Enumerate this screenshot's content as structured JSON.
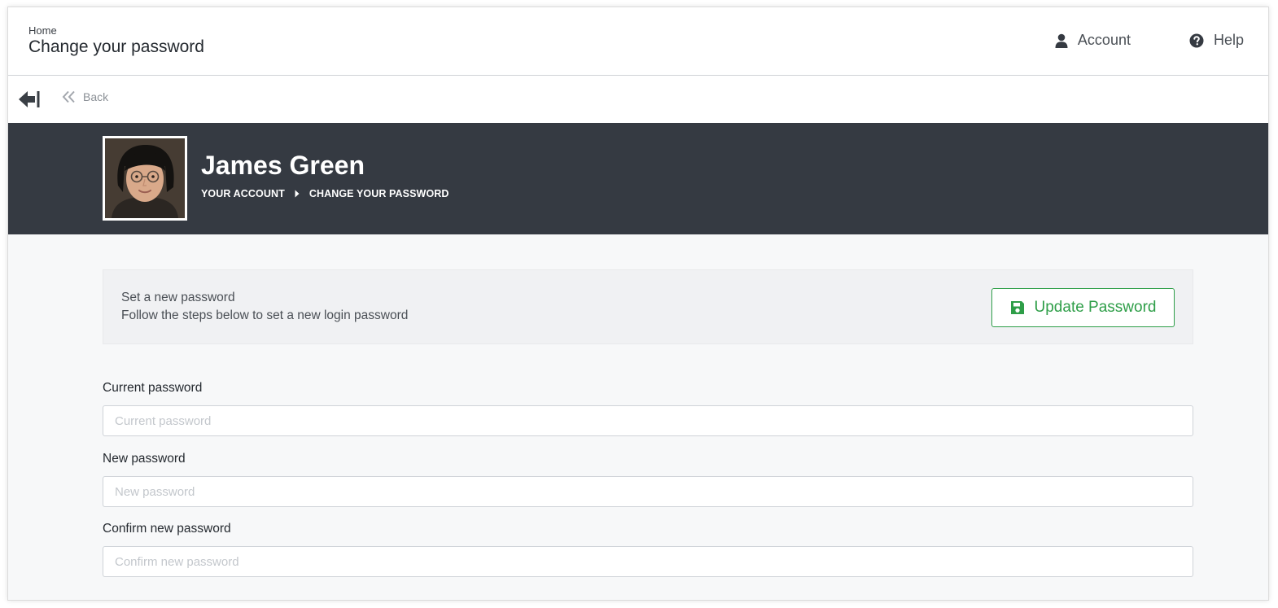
{
  "header": {
    "breadcrumb_home": "Home",
    "title": "Change your password",
    "account_label": "Account",
    "help_label": "Help"
  },
  "toolbar": {
    "back_label": "Back"
  },
  "profile": {
    "name": "James Green",
    "crumbs": [
      "YOUR ACCOUNT",
      "CHANGE YOUR PASSWORD"
    ]
  },
  "info": {
    "title": "Set a new password",
    "subtitle": "Follow the steps below to set a new login password",
    "update_button": "Update Password"
  },
  "form": {
    "current": {
      "label": "Current password",
      "value": "",
      "placeholder": "Current password"
    },
    "new": {
      "label": "New password",
      "value": "",
      "placeholder": "New password"
    },
    "confirm": {
      "label": "Confirm new password",
      "value": "",
      "placeholder": "Confirm new password"
    }
  },
  "colors": {
    "accent_green": "#2e9e48",
    "band_dark": "#353a42",
    "page_bg": "#f7f8f9"
  },
  "icons": {
    "account": "user-icon",
    "help": "question-circle-icon",
    "collapse": "arrow-left-bar-icon",
    "back": "double-chevron-left-icon",
    "crumb_sep": "caret-right-icon",
    "save": "floppy-disk-icon"
  }
}
